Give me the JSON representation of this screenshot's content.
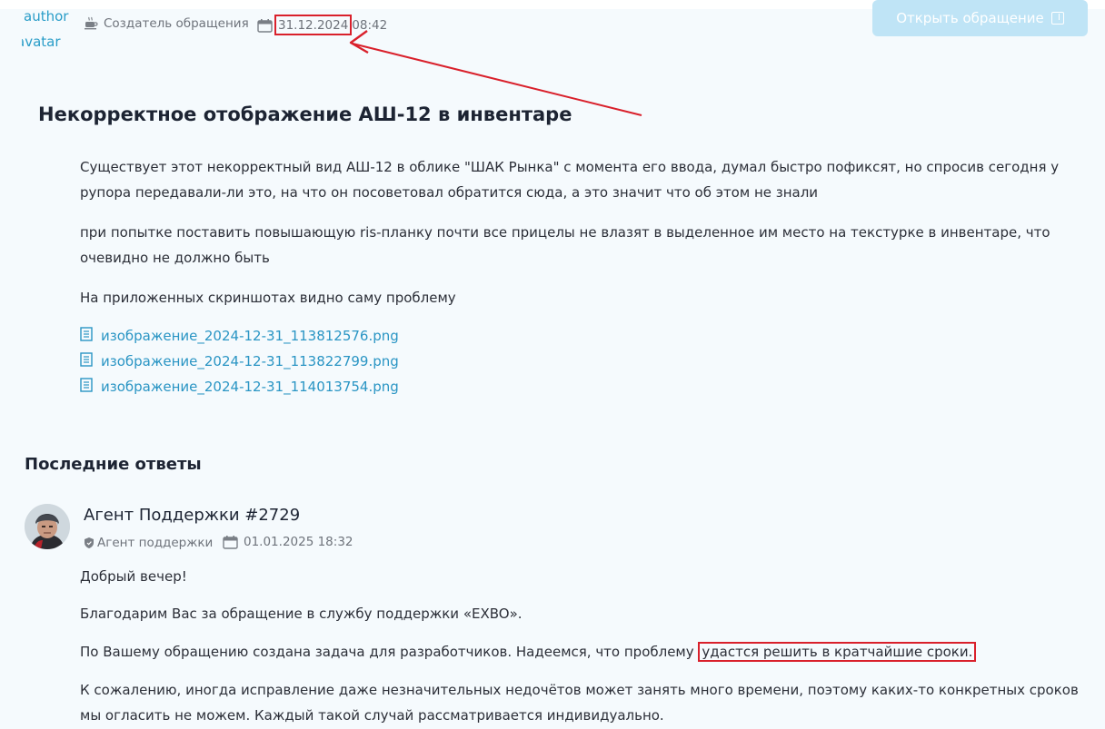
{
  "header": {
    "author_line1": "author",
    "author_line2": "avatar",
    "creator_label": "Создатель обращения",
    "date": "31.12.2024",
    "time": "08:42",
    "open_button_label": "Открыть обращение"
  },
  "ticket": {
    "title": "Некорректное отображение АШ-12 в инвентаре",
    "paragraphs": [
      "Существует этот некорректный вид АШ-12 в облике \"ШАК Рынка\" с момента его ввода, думал быстро пофиксят, но спросив сегодня у рупора передавали-ли это, на что он посоветовал обратится сюда, а это значит что об этом не знали",
      "при попытке поставить повышающую ris-планку почти все прицелы не влазят в выделенное им место на текстурке в инвентаре, что очевидно не должно быть",
      "На приложенных скриншотах видно саму проблему"
    ],
    "attachments": [
      "изображение_2024-12-31_113812576.png",
      "изображение_2024-12-31_113822799.png",
      "изображение_2024-12-31_114013754.png"
    ]
  },
  "replies": {
    "section_title": "Последние ответы",
    "agent_name": "Агент Поддержки #2729",
    "agent_role": "Агент поддержки",
    "datetime": "01.01.2025 18:32",
    "paragraphs": {
      "p1": "Добрый вечер!",
      "p2": "Благодарим Вас за обращение в службу поддержки «EXBO».",
      "p3_before": "По Вашему обращению создана задача для разработчиков. Надеемся, что проблему ",
      "p3_highlight": "удастся решить в кратчайшие сроки.",
      "p4": "К сожалению, иногда исправление даже незначительных недочётов может занять много времени, поэтому каких-то конкретных сроков мы огласить не можем. Каждый такой случай рассматривается индивидуально."
    }
  },
  "colors": {
    "accent": "#2a95c4",
    "highlight": "#d9202b",
    "button": "#bfe4f6"
  }
}
